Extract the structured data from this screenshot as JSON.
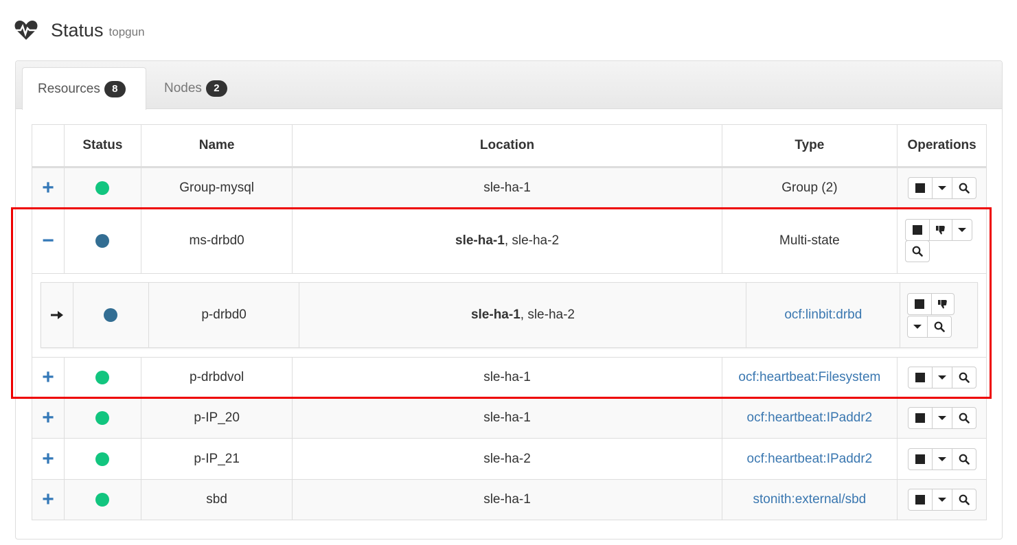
{
  "header": {
    "title": "Status",
    "subtitle": "topgun",
    "icon": "heartbeat-icon"
  },
  "tabs": [
    {
      "label": "Resources",
      "count": "8",
      "active": true
    },
    {
      "label": "Nodes",
      "count": "2",
      "active": false
    }
  ],
  "table": {
    "columns": [
      "",
      "Status",
      "Name",
      "Location",
      "Type",
      "Operations"
    ],
    "rows": [
      {
        "expander": "+",
        "status": "running",
        "name": "Group-mysql",
        "location_bold": "",
        "location": "sle-ha-1",
        "type": "Group (2)",
        "type_link": false
      },
      {
        "expander": "−",
        "status": "master",
        "name": "ms-drbd0",
        "location_bold": "sle-ha-1",
        "location": ", sle-ha-2",
        "type": "Multi-state",
        "type_link": false
      },
      {
        "expander": "→",
        "status": "master",
        "name": "p-drbd0",
        "location_bold": "sle-ha-1",
        "location": ", sle-ha-2",
        "type": "ocf:linbit:drbd",
        "type_link": true,
        "nested": true
      },
      {
        "expander": "+",
        "status": "running",
        "name": "p-drbdvol",
        "location_bold": "",
        "location": "sle-ha-1",
        "type": "ocf:heartbeat:Filesystem",
        "type_link": true
      },
      {
        "expander": "+",
        "status": "running",
        "name": "p-IP_20",
        "location_bold": "",
        "location": "sle-ha-1",
        "type": "ocf:heartbeat:IPaddr2",
        "type_link": true
      },
      {
        "expander": "+",
        "status": "running",
        "name": "p-IP_21",
        "location_bold": "",
        "location": "sle-ha-2",
        "type": "ocf:heartbeat:IPaddr2",
        "type_link": true
      },
      {
        "expander": "+",
        "status": "running",
        "name": "sbd",
        "location_bold": "",
        "location": "sle-ha-1",
        "type": "stonith:external/sbd",
        "type_link": true
      }
    ]
  },
  "colors": {
    "running": "#12c57f",
    "master": "#336e93",
    "link": "#3a77b0",
    "highlight": "#ee0000"
  }
}
